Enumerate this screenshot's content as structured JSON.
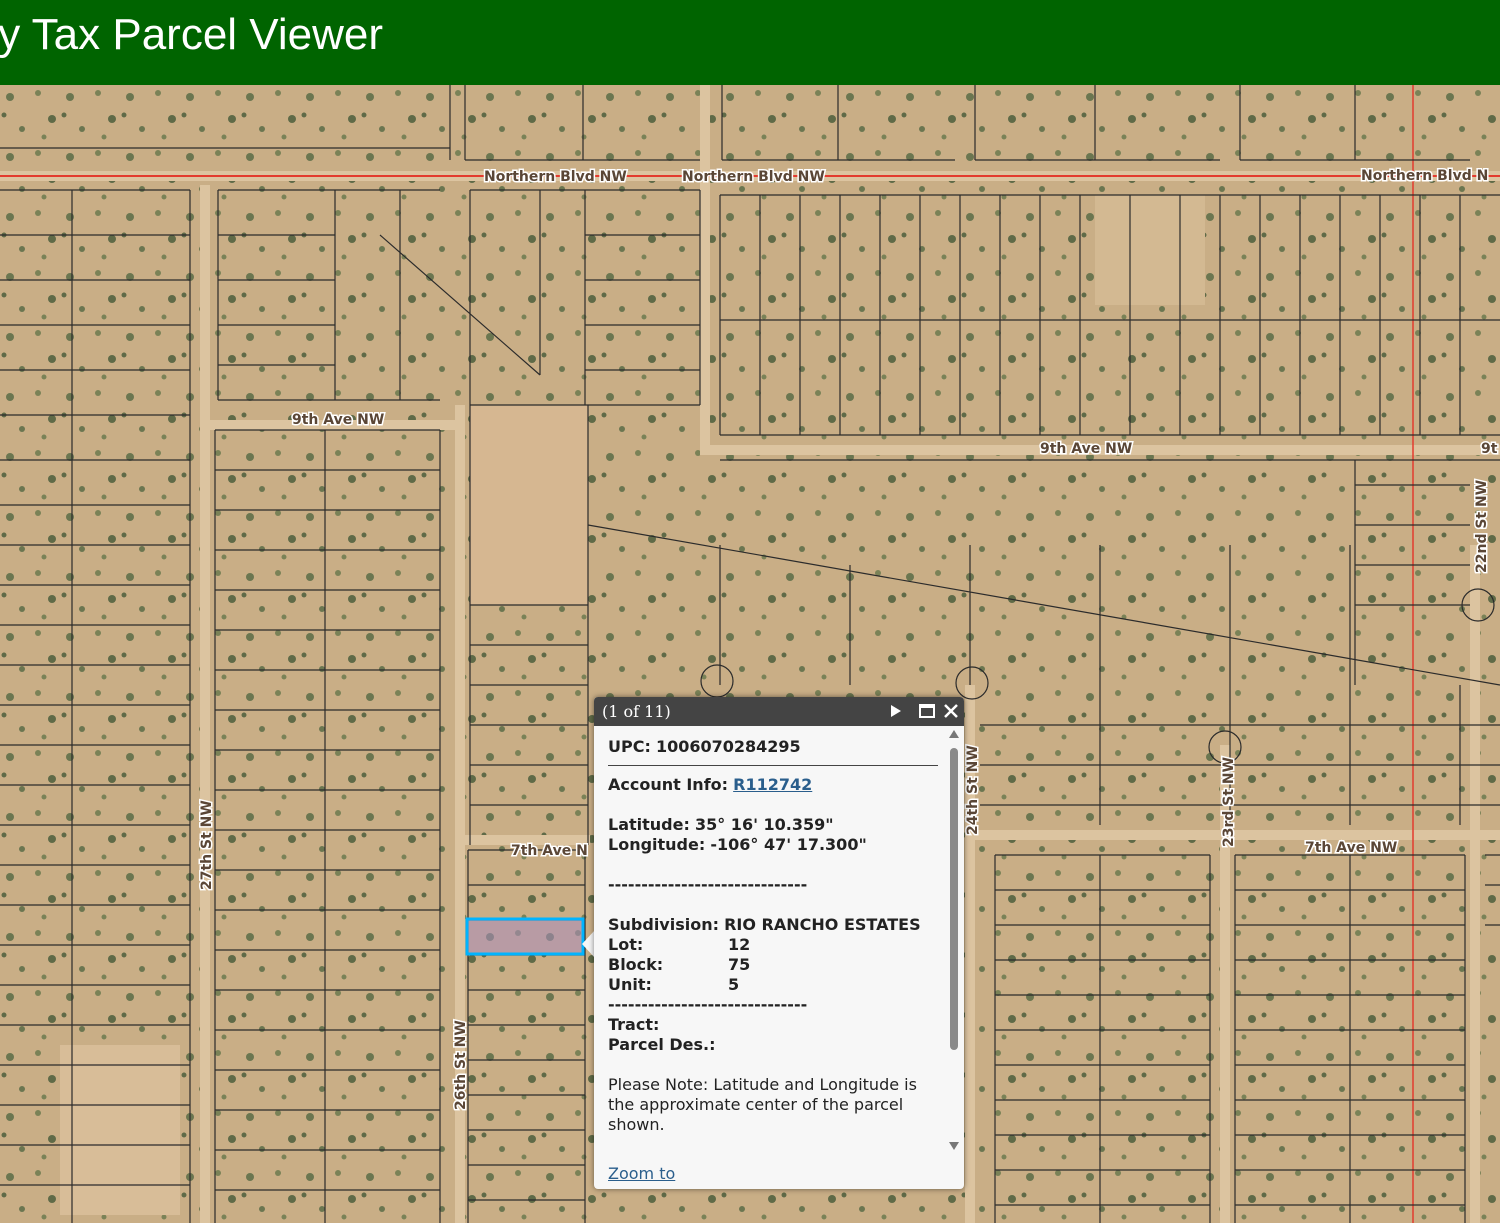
{
  "header": {
    "title": "ty Tax Parcel Viewer"
  },
  "map": {
    "road_labels": {
      "northern_1": "Northern Blvd NW",
      "northern_2": "Northern Blvd NW",
      "northern_3": "Northern Blvd N",
      "ninth_w": "9th Ave NW",
      "ninth_e": "9th Ave NW",
      "ninth_edge": "9t",
      "seventh_w": "7th Ave N",
      "seventh_e": "7th Ave NW",
      "st27": "27th St NW",
      "st26": "26th St NW",
      "st24": "24th St NW",
      "st23": "23rd St NW",
      "st22": "22nd St NW"
    }
  },
  "popup": {
    "counter": "(1 of 11)",
    "upc_label": "UPC:",
    "upc_value": "1006070284295",
    "account_label": "Account Info:",
    "account_value": "R112742",
    "latitude_label": "Latitude:",
    "latitude_value": "35° 16' 10.359\"",
    "longitude_label": "Longitude:",
    "longitude_value": "-106° 47' 17.300\"",
    "dashes": "------------------------------",
    "subdivision_label": "Subdivision:",
    "subdivision_value": "RIO RANCHO ESTATES",
    "lot_label": "Lot:",
    "lot_value": "12",
    "block_label": "Block:",
    "block_value": "75",
    "unit_label": "Unit:",
    "unit_value": "5",
    "tract_label": "Tract:",
    "parcel_des_label": "Parcel Des.:",
    "note": "Please Note: Latitude and Longitude is the approximate center of the parcel shown.",
    "zoom_to": "Zoom to"
  },
  "colors": {
    "header_bg": "#006400",
    "map_land": "#c8ad85",
    "parcel_line": "#2b2b2b",
    "major_road": "#e33b2e",
    "selected_parcel": "#00b4ff",
    "popup_title_bg": "#444444",
    "link": "#2a5e8c"
  },
  "icons": {
    "next": "play-icon",
    "maximize": "maximize-icon",
    "close": "close-icon",
    "scroll_up": "triangle-up-icon",
    "scroll_down": "triangle-down-icon"
  }
}
